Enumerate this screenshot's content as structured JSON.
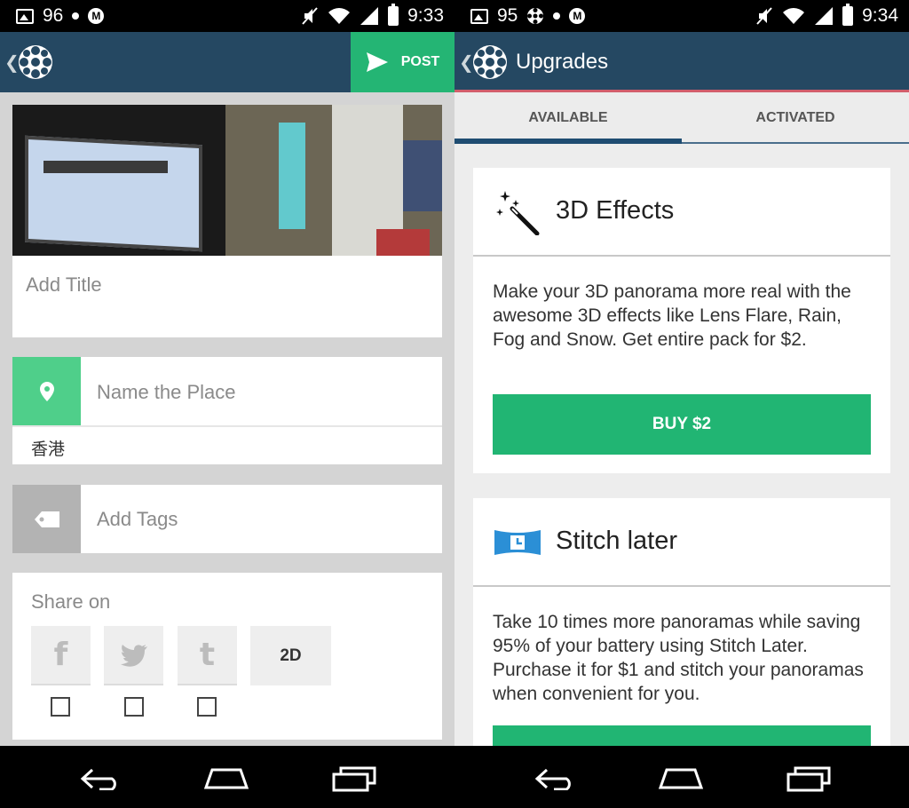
{
  "left": {
    "status": {
      "notif_count": "96",
      "time": "9:33"
    },
    "appbar": {
      "post_label": "POST"
    },
    "title_field": {
      "placeholder": "Add Title"
    },
    "place_field": {
      "placeholder": "Name the Place",
      "value": "香港"
    },
    "tags_field": {
      "placeholder": "Add Tags"
    },
    "share": {
      "label": "Share on",
      "facebook_glyph": "f",
      "twitter_glyph": "twitter-bird",
      "tumblr_glyph": "t",
      "mode_label": "2D"
    }
  },
  "right": {
    "status": {
      "notif_count": "95",
      "time": "9:34"
    },
    "appbar": {
      "title": "Upgrades"
    },
    "tabs": [
      {
        "label": "AVAILABLE",
        "active": true
      },
      {
        "label": "ACTIVATED",
        "active": false
      }
    ],
    "upgrades": [
      {
        "icon": "magic-wand-icon",
        "title": "3D Effects",
        "description": "Make your 3D panorama more real with the awesome 3D effects like Lens Flare, Rain, Fog and Snow. Get entire pack for $2.",
        "button_label": "BUY $2"
      },
      {
        "icon": "panorama-clock-icon",
        "title": "Stitch later",
        "description": "Take 10 times more panoramas while saving 95% of your battery using Stitch Later. Purchase it for $1 and stitch your panoramas when convenient for you."
      }
    ]
  },
  "colors": {
    "appbar": "#254862",
    "accent_green": "#24b574",
    "tab_indicator": "#1f4d72",
    "appbar_underline": "#d25e6b"
  }
}
